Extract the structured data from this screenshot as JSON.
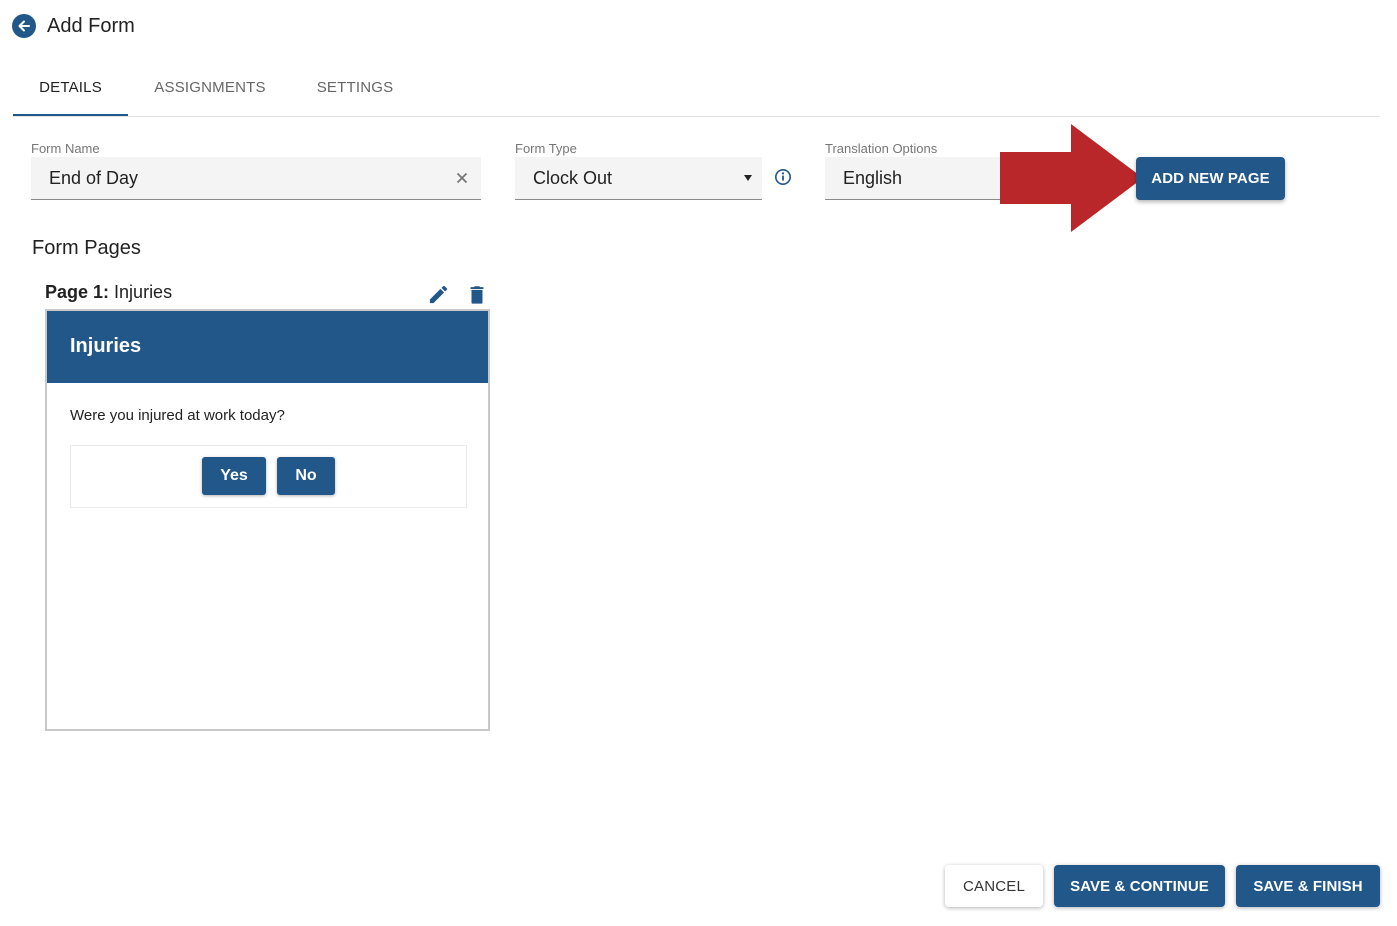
{
  "header": {
    "title": "Add Form",
    "back_icon": "arrow-left-circle-icon"
  },
  "tabs": [
    {
      "label": "DETAILS",
      "active": true
    },
    {
      "label": "ASSIGNMENTS",
      "active": false
    },
    {
      "label": "SETTINGS",
      "active": false
    }
  ],
  "fields": {
    "form_name": {
      "label": "Form Name",
      "value": "End of Day"
    },
    "form_type": {
      "label": "Form Type",
      "value": "Clock Out"
    },
    "translation": {
      "label": "Translation Options",
      "value": "English"
    }
  },
  "add_new_page_label": "ADD NEW PAGE",
  "form_pages": {
    "title": "Form Pages",
    "pages": [
      {
        "prefix": "Page 1:",
        "name": "Injuries",
        "card_title": "Injuries",
        "question": "Were you injured at work today?",
        "options": [
          "Yes",
          "No"
        ]
      }
    ]
  },
  "footer": {
    "cancel": "CANCEL",
    "save_continue": "SAVE & CONTINUE",
    "save_finish": "SAVE & FINISH"
  },
  "colors": {
    "primary": "#22578a",
    "annotation_arrow": "#b9272a"
  }
}
